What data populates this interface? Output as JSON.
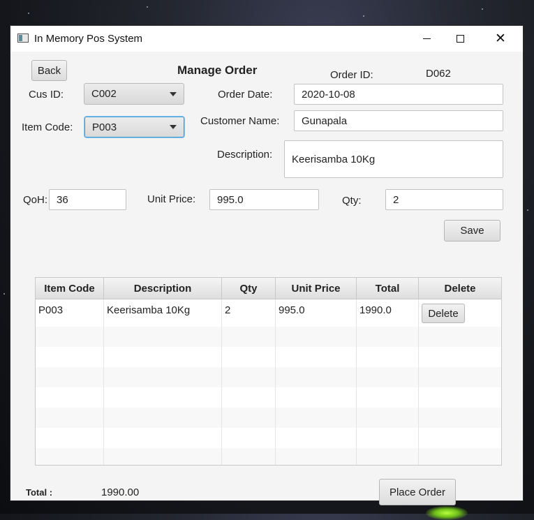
{
  "window": {
    "title": "In Memory Pos System"
  },
  "form": {
    "back_label": "Back",
    "heading": "Manage Order",
    "order_id_label": "Order ID:",
    "order_id_value": "D062",
    "cus_id_label": "Cus ID:",
    "cus_id_value": "C002",
    "order_date_label": "Order Date:",
    "order_date_value": "2020-10-08",
    "item_code_label": "Item Code:",
    "item_code_value": "P003",
    "customer_name_label": "Customer Name:",
    "customer_name_value": "Gunapala",
    "description_label": "Description:",
    "description_value": "Keerisamba 10Kg",
    "qoh_label": "QoH:",
    "qoh_value": "36",
    "unit_price_label": "Unit Price:",
    "unit_price_value": "995.0",
    "qty_label": "Qty:",
    "qty_value": "2",
    "save_label": "Save"
  },
  "table": {
    "columns": [
      "Item Code",
      "Description",
      "Qty",
      "Unit Price",
      "Total",
      "Delete"
    ],
    "rows": [
      {
        "item_code": "P003",
        "description": "Keerisamba 10Kg",
        "qty": "2",
        "unit_price": "995.0",
        "total": "1990.0",
        "delete_label": "Delete"
      }
    ]
  },
  "footer": {
    "total_label": "Total :",
    "total_value": "1990.00",
    "place_order_label": "Place Order"
  }
}
